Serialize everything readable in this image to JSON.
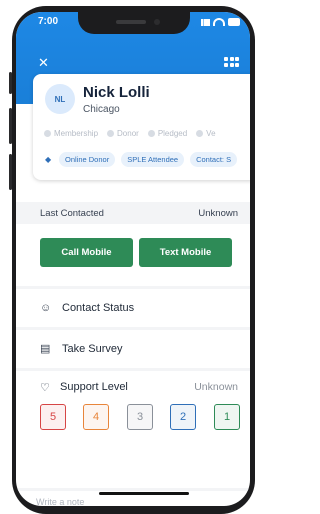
{
  "status_bar": {
    "time": "7:00"
  },
  "contact": {
    "initials": "NL",
    "name": "Nick Lolli",
    "city": "Chicago",
    "statuses": [
      "Membership",
      "Donor",
      "Pledged",
      "Ve"
    ],
    "tags": [
      "Online Donor",
      "SPLE Attendee",
      "Contact: S"
    ]
  },
  "last_contacted": {
    "label": "Last Contacted",
    "value": "Unknown"
  },
  "actions": {
    "call": "Call Mobile",
    "text": "Text Mobile"
  },
  "menu": {
    "contact_status": "Contact Status",
    "take_survey": "Take Survey"
  },
  "support_level": {
    "label": "Support Level",
    "value": "Unknown",
    "levels": [
      "5",
      "4",
      "3",
      "2",
      "1"
    ],
    "colors": [
      "#d64545",
      "#e8853a",
      "#8a9099",
      "#2f6fb8",
      "#2e8b57"
    ]
  },
  "note": {
    "placeholder": "Write a note"
  },
  "colors": {
    "header": "#1e88e5",
    "action_green": "#2e8b57",
    "tag_blue": "#2f6fb8"
  }
}
